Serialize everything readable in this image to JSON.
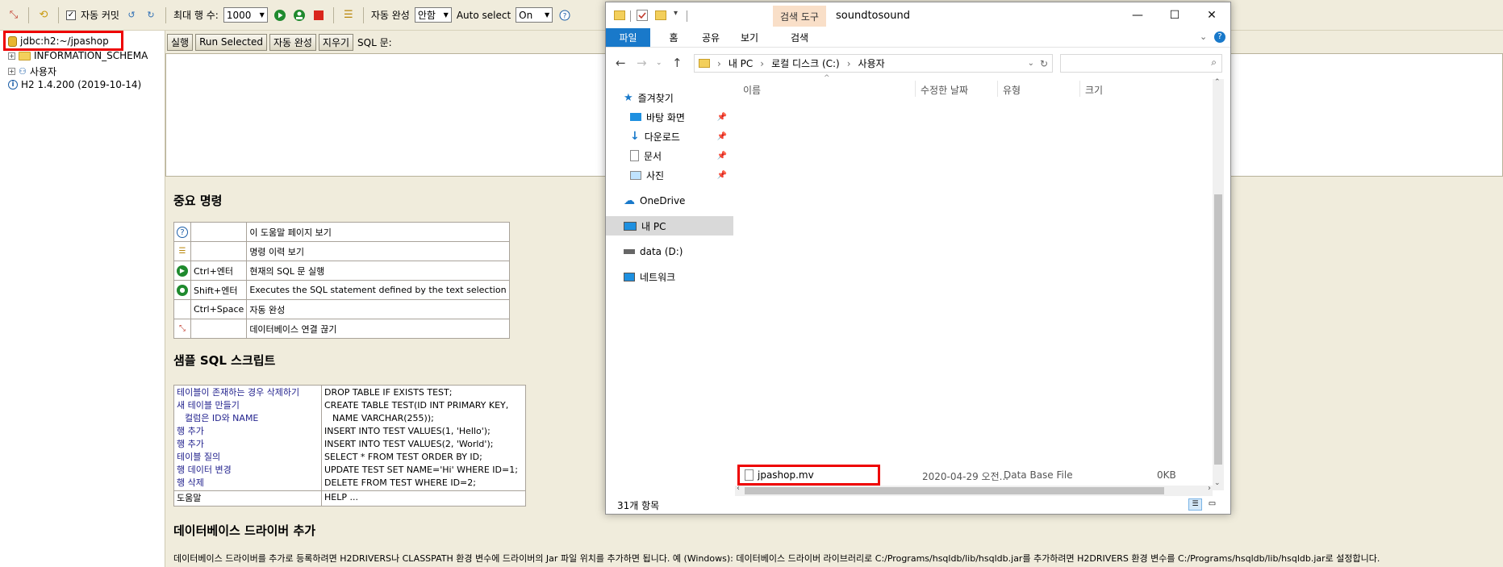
{
  "h2_console": {
    "toolbar": {
      "auto_commit_label": "자동 커밋",
      "max_rows_label": "최대 행 수:",
      "max_rows_value": "1000",
      "autocomplete_label": "자동 완성",
      "autocomplete_value": "안함",
      "auto_select_label": "Auto select",
      "auto_select_value": "On"
    },
    "tree": {
      "connection": "jdbc:h2:~/jpashop",
      "items": [
        "INFORMATION_SCHEMA",
        "사용자"
      ],
      "version": "H2 1.4.200 (2019-10-14)"
    },
    "sql_toolbar": {
      "run": "실행",
      "run_selected": "Run Selected",
      "autocomplete": "자동 완성",
      "clear": "지우기",
      "sql_label": "SQL 문:"
    },
    "help": {
      "important_title": "중요 명령",
      "commands": [
        {
          "icon": "help-icon",
          "key": "",
          "desc": "이 도움말 페이지 보기"
        },
        {
          "icon": "history-icon",
          "key": "",
          "desc": "명령 이력 보기"
        },
        {
          "icon": "run-icon",
          "key": "Ctrl+엔터",
          "desc": "현재의 SQL 문 실행"
        },
        {
          "icon": "run-selected-icon",
          "key": "Shift+엔터",
          "desc": "Executes the SQL statement defined by the text selection"
        },
        {
          "icon": "",
          "key": "Ctrl+Space",
          "desc": "자동 완성"
        },
        {
          "icon": "disconnect-icon",
          "key": "",
          "desc": "데이터베이스 연결 끊기"
        }
      ],
      "sample_title": "샘플 SQL 스크립트",
      "sample_left": [
        "테이블이 존재하는 경우 삭제하기",
        "새 테이블 만들기",
        "컬럼은 ID와 NAME",
        "행 추가",
        "행 추가",
        "테이블 질의",
        "행 데이터 변경",
        "행 삭제"
      ],
      "sample_right": [
        "DROP TABLE IF EXISTS TEST;",
        "CREATE TABLE TEST(ID INT PRIMARY KEY,",
        "NAME VARCHAR(255));",
        "INSERT INTO TEST VALUES(1, 'Hello');",
        "INSERT INTO TEST VALUES(2, 'World');",
        "SELECT * FROM TEST ORDER BY ID;",
        "UPDATE TEST SET NAME='Hi' WHERE ID=1;",
        "DELETE FROM TEST WHERE ID=2;"
      ],
      "help_left": "도움말",
      "help_right": "HELP ...",
      "driver_title": "데이터베이스 드라이버 추가",
      "driver_text": "데이터베이스 드라이버를 추가로 등록하려면 H2DRIVERS나 CLASSPATH 환경 변수에 드라이버의 Jar 파일 위치를 추가하면 됩니다. 예 (Windows): 데이터베이스 드라이버 라이브러리로 C:/Programs/hsqldb/lib/hsqldb.jar를 추가하려면 H2DRIVERS 환경 변수를 C:/Programs/hsqldb/lib/hsqldb.jar로 설정합니다."
    }
  },
  "explorer": {
    "search_tools_tab": "검색 도구",
    "title": "soundtosound",
    "ribbon_tabs": [
      "파일",
      "홈",
      "공유",
      "보기",
      "검색"
    ],
    "breadcrumb": [
      "내 PC",
      "로컬 디스크 (C:)",
      "사용자"
    ],
    "nav": [
      {
        "label": "즐겨찾기",
        "icon": "star-icon"
      },
      {
        "label": "바탕 화면",
        "icon": "desktop-icon",
        "pinned": true
      },
      {
        "label": "다운로드",
        "icon": "download-icon",
        "pinned": true
      },
      {
        "label": "문서",
        "icon": "document-icon",
        "pinned": true
      },
      {
        "label": "사진",
        "icon": "picture-icon",
        "pinned": true
      },
      {
        "label": "OneDrive",
        "icon": "cloud-icon"
      },
      {
        "label": "내 PC",
        "icon": "pc-icon",
        "selected": true
      },
      {
        "label": "data (D:)",
        "icon": "drive-icon"
      },
      {
        "label": "네트워크",
        "icon": "network-icon"
      }
    ],
    "columns": [
      "이름",
      "수정한 날짜",
      "유형",
      "크기"
    ],
    "file": {
      "name": "jpashop.mv",
      "date": "2020-04-29 오전...",
      "type": "Data Base File",
      "size": "0KB"
    },
    "status": "31개 항목"
  },
  "colors": {
    "highlight": "#e00000",
    "ribbon_file": "#1979ca",
    "search_tools": "#f9dfc8",
    "console_bg": "#f0ecdc"
  }
}
